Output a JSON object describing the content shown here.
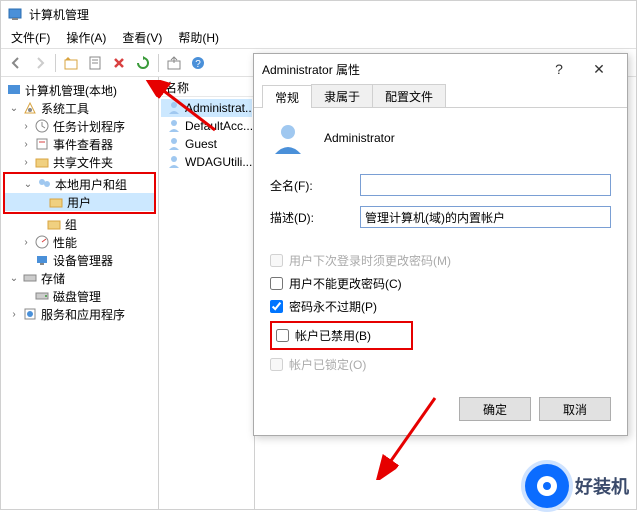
{
  "window": {
    "title": "计算机管理"
  },
  "menu": {
    "file": "文件(F)",
    "action": "操作(A)",
    "view": "查看(V)",
    "help": "帮助(H)"
  },
  "tree": {
    "root": "计算机管理(本地)",
    "system_tools": "系统工具",
    "task_scheduler": "任务计划程序",
    "event_viewer": "事件查看器",
    "shared_folders": "共享文件夹",
    "local_users": "本地用户和组",
    "users": "用户",
    "groups": "组",
    "performance": "性能",
    "device_manager": "设备管理器",
    "storage": "存储",
    "disk_management": "磁盘管理",
    "services": "服务和应用程序"
  },
  "list": {
    "header_name": "名称",
    "items": [
      "Administrat...",
      "DefaultAcc...",
      "Guest",
      "WDAGUtili..."
    ]
  },
  "dialog": {
    "title": "Administrator 属性",
    "tabs": {
      "general": "常规",
      "memberof": "隶属于",
      "profile": "配置文件"
    },
    "account_name": "Administrator",
    "fullname_label": "全名(F):",
    "fullname_value": "",
    "desc_label": "描述(D):",
    "desc_value": "管理计算机(域)的内置帐户",
    "chk_must_change": "用户下次登录时须更改密码(M)",
    "chk_cannot_change": "用户不能更改密码(C)",
    "chk_never_expire": "密码永不过期(P)",
    "chk_disabled": "帐户已禁用(B)",
    "chk_locked": "帐户已锁定(O)",
    "ok": "确定",
    "cancel": "取消"
  },
  "watermark": "好装机"
}
